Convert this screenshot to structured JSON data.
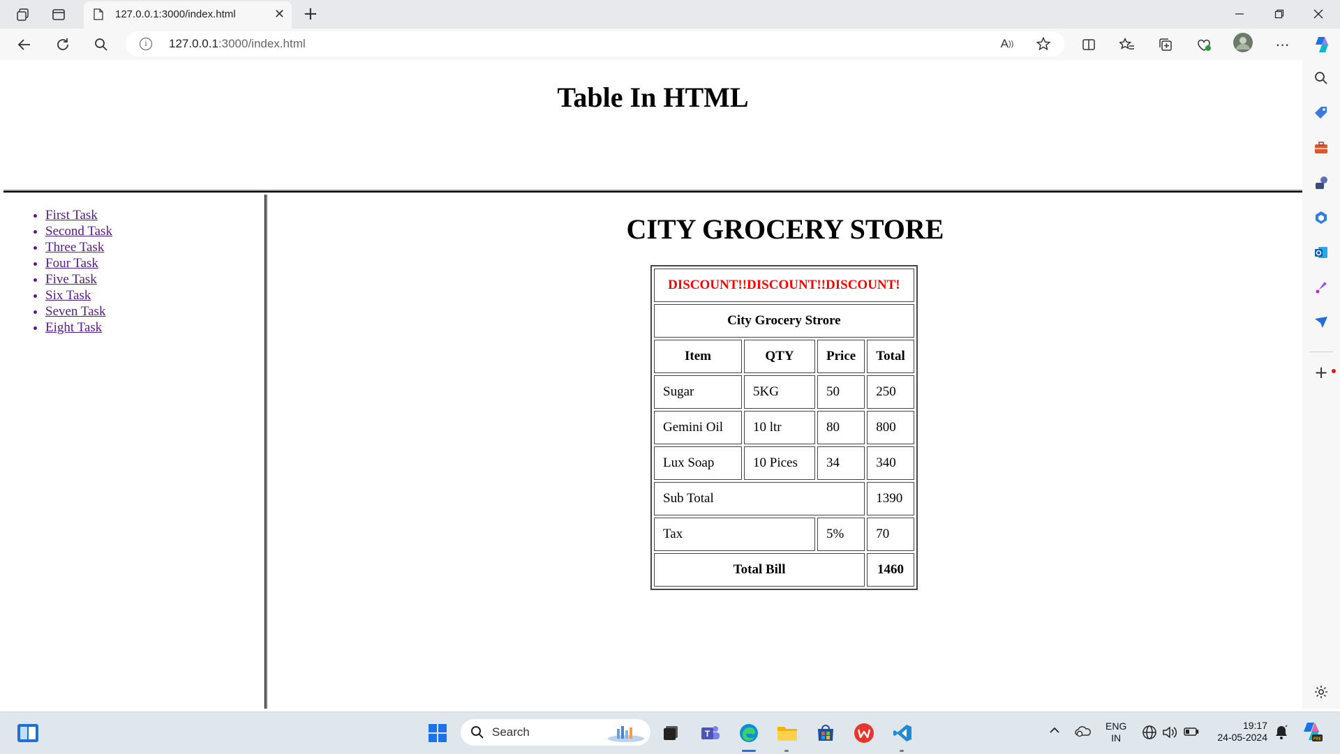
{
  "browser": {
    "tab_title": "127.0.0.1:3000/index.html",
    "url_host": "127.0.0.1",
    "url_rest": ":3000/index.html"
  },
  "page": {
    "title": "Table In HTML",
    "nav_links": [
      "First Task",
      "Second Task",
      "Three Task",
      "Four Task",
      "Five Task",
      "Six Task",
      "Seven Task",
      "Eight Task"
    ],
    "store_title": "CITY GROCERY STORE",
    "table": {
      "banner": "DISCOUNT!!DISCOUNT!!DISCOUNT!",
      "caption": "City Grocery Strore",
      "headers": [
        "Item",
        "QTY",
        "Price",
        "Total"
      ],
      "rows": [
        [
          "Sugar",
          "5KG",
          "50",
          "250"
        ],
        [
          "Gemini Oil",
          "10 ltr",
          "80",
          "800"
        ],
        [
          "Lux Soap",
          "10 Pices",
          "34",
          "340"
        ]
      ],
      "subtotal_label": "Sub Total",
      "subtotal_value": "1390",
      "tax_label": "Tax",
      "tax_rate": "5%",
      "tax_value": "70",
      "total_label": "Total Bill",
      "total_value": "1460"
    }
  },
  "taskbar": {
    "search_placeholder": "Search",
    "lang_line1": "ENG",
    "lang_line2": "IN",
    "time": "19:17",
    "date": "24-05-2024"
  },
  "colors": {
    "discount_red": "#ff0000",
    "visited_link": "#551a8b",
    "edge_blue": "#0a66d8"
  }
}
